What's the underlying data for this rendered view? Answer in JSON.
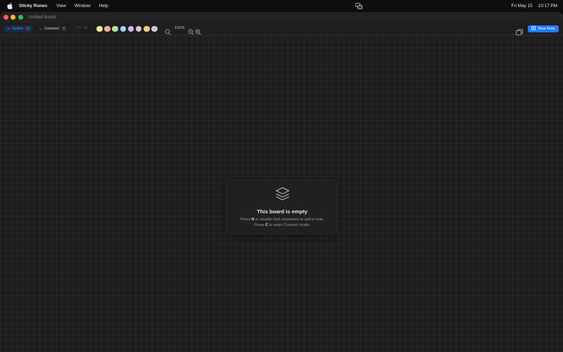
{
  "menubar": {
    "app_name": "Sticky Runes",
    "items": [
      "View",
      "Window",
      "Help"
    ],
    "date": "Fri May 15",
    "time": "10:17 PM"
  },
  "window": {
    "title": "Untitled Board"
  },
  "toolbar": {
    "select_label": "Select",
    "select_shortcut": "V",
    "connect_label": "Connect",
    "connect_shortcut": "C",
    "swatch_colors": [
      "#f6e58d",
      "#f7a8a0",
      "#a8e6a1",
      "#9fd3f0",
      "#d6b6f2",
      "#f5b7d6",
      "#f4c98e",
      "#c8c8c8"
    ],
    "zoom_level": "100%",
    "new_note_label": "New Note"
  },
  "empty_state": {
    "title": "This board is empty",
    "line1_prefix": "Press ",
    "line1_key": "N",
    "line1_suffix": " or double-click anywhere to add a note.",
    "line2_prefix": "Press ",
    "line2_key": "C",
    "line2_suffix": " to enter Connect mode."
  },
  "colors": {
    "accent": "#1f7bff",
    "select_bg": "#1b2a45"
  }
}
